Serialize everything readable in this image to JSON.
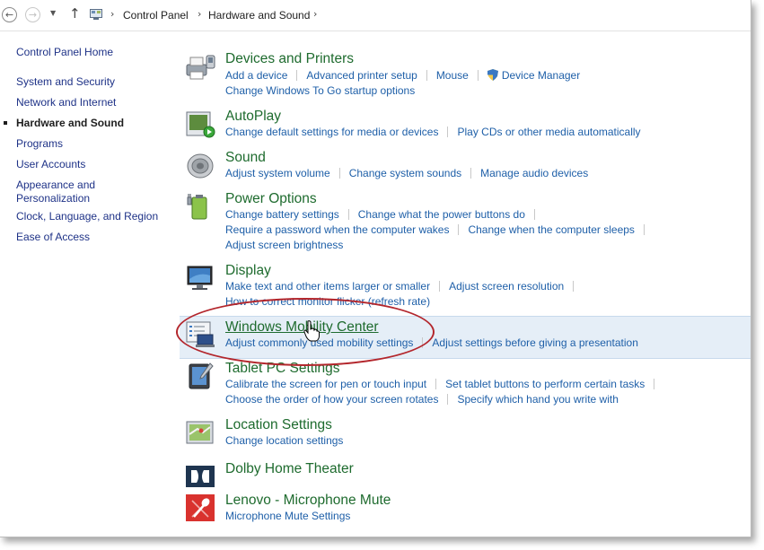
{
  "breadcrumb": [
    "Control Panel",
    "Hardware and Sound"
  ],
  "sidebar": {
    "items": [
      {
        "label": "Control Panel Home"
      },
      {
        "label": "System and Security"
      },
      {
        "label": "Network and Internet"
      },
      {
        "label": "Hardware and Sound",
        "current": true
      },
      {
        "label": "Programs"
      },
      {
        "label": "User Accounts"
      },
      {
        "label": "Appearance and"
      },
      {
        "label": "Personalization"
      },
      {
        "label": "Clock, Language, and Region"
      },
      {
        "label": "Ease of Access"
      }
    ]
  },
  "categories": {
    "devices": {
      "title": "Devices and Printers",
      "links": [
        "Add a device",
        "Advanced printer setup",
        "Mouse",
        "Device Manager",
        "Change Windows To Go startup options"
      ]
    },
    "autoplay": {
      "title": "AutoPlay",
      "links": [
        "Change default settings for media or devices",
        "Play CDs or other media automatically"
      ]
    },
    "sound": {
      "title": "Sound",
      "links": [
        "Adjust system volume",
        "Change system sounds",
        "Manage audio devices"
      ]
    },
    "power": {
      "title": "Power Options",
      "links": [
        "Change battery settings",
        "Change what the power buttons do",
        "Require a password when the computer wakes",
        "Change when the computer sleeps",
        "Adjust screen brightness"
      ]
    },
    "display": {
      "title": "Display",
      "links": [
        "Make text and other items larger or smaller",
        "Adjust screen resolution",
        "How to correct monitor flicker (refresh rate)"
      ]
    },
    "mobility": {
      "title": "Windows Mobility Center",
      "links": [
        "Adjust commonly used mobility settings",
        "Adjust settings before giving a presentation"
      ]
    },
    "tablet": {
      "title": "Tablet PC Settings",
      "links": [
        "Calibrate the screen for pen or touch input",
        "Set tablet buttons to perform certain tasks",
        "Choose the order of how your screen rotates",
        "Specify which hand you write with"
      ]
    },
    "location": {
      "title": "Location Settings",
      "links": [
        "Change location settings"
      ]
    },
    "dolby": {
      "title": "Dolby Home Theater"
    },
    "lenovo": {
      "title": "Lenovo - Microphone Mute",
      "links": [
        "Microphone Mute Settings"
      ]
    }
  },
  "colors": {
    "title_green": "#1e6b2e",
    "link_blue": "#1e5fa8",
    "nav_blue": "#1e3287",
    "highlight": "#e5eef7",
    "annotation_red": "#b3262c"
  }
}
